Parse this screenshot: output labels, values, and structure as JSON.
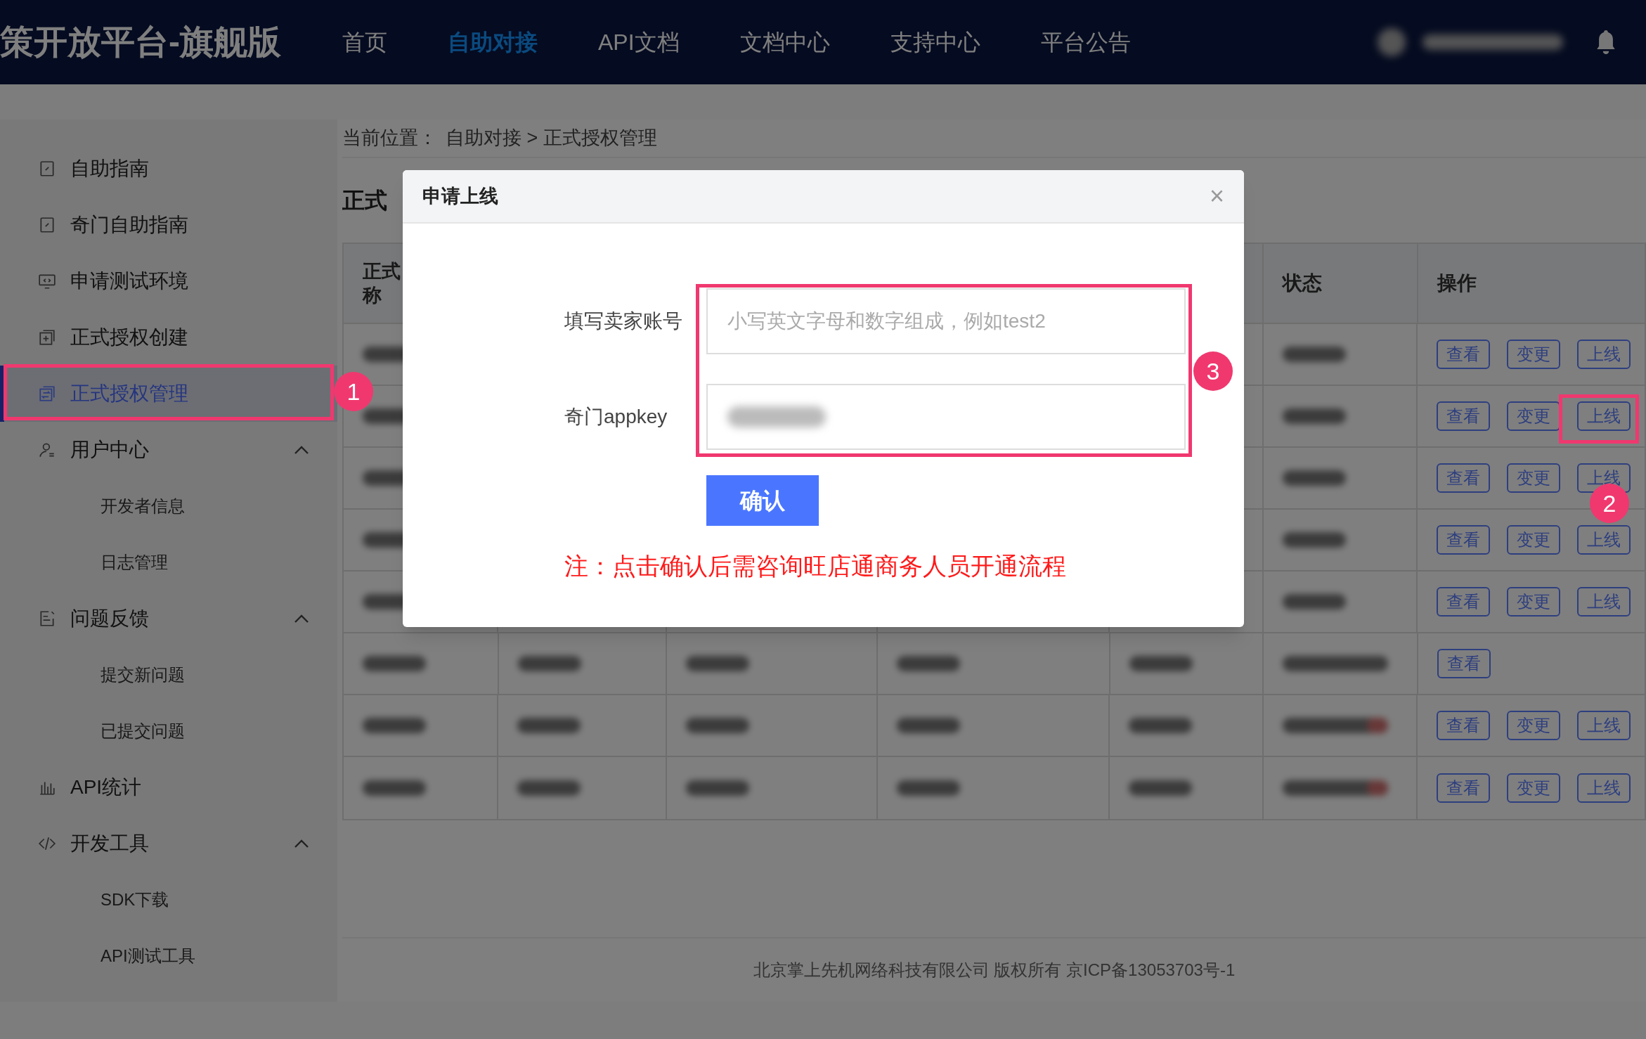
{
  "header": {
    "logo": "策开放平台-旗舰版",
    "nav": [
      {
        "label": "首页",
        "selected": false
      },
      {
        "label": "自助对接",
        "selected": true
      },
      {
        "label": "API文档",
        "selected": false
      },
      {
        "label": "文档中心",
        "selected": false
      },
      {
        "label": "支持中心",
        "selected": false
      },
      {
        "label": "平台公告",
        "selected": false
      }
    ]
  },
  "sidebar": {
    "items": [
      {
        "label": "自助指南",
        "kind": "guide",
        "selected": false
      },
      {
        "label": "奇门自助指南",
        "kind": "guide",
        "selected": false
      },
      {
        "label": "申请测试环境",
        "kind": "monitor",
        "selected": false
      },
      {
        "label": "正式授权创建",
        "kind": "add",
        "selected": false
      },
      {
        "label": "正式授权管理",
        "kind": "manage",
        "selected": true
      },
      {
        "label": "用户中心",
        "kind": "user",
        "selected": false,
        "expanded": true,
        "children": [
          {
            "label": "开发者信息"
          },
          {
            "label": "日志管理"
          }
        ]
      },
      {
        "label": "问题反馈",
        "kind": "feedback",
        "selected": false,
        "expanded": true,
        "children": [
          {
            "label": "提交新问题"
          },
          {
            "label": "已提交问题"
          }
        ]
      },
      {
        "label": "API统计",
        "kind": "chart",
        "selected": false
      },
      {
        "label": "开发工具",
        "kind": "code",
        "selected": false,
        "expanded": true,
        "children": [
          {
            "label": "SDK下载"
          },
          {
            "label": "API测试工具"
          }
        ]
      }
    ]
  },
  "breadcrumb": {
    "prefix": "当前位置：",
    "path": "自助对接 > 正式授权管理"
  },
  "page_title": "正式",
  "table": {
    "column_1": [
      "正式",
      "称"
    ],
    "status_header": "状态",
    "actions_header": "操作",
    "rows": [
      {
        "actions": [
          "查看",
          "变更",
          "上线"
        ]
      },
      {
        "actions": [
          "查看",
          "变更",
          "上线"
        ]
      },
      {
        "actions": [
          "查看",
          "变更",
          "上线"
        ]
      },
      {
        "actions": [
          "查看",
          "变更",
          "上线"
        ]
      },
      {
        "actions": [
          "查看",
          "变更",
          "上线"
        ]
      },
      {
        "actions": [
          "查看"
        ]
      },
      {
        "actions": [
          "查看",
          "变更",
          "上线"
        ]
      },
      {
        "actions": [
          "查看",
          "变更",
          "上线"
        ]
      }
    ]
  },
  "modal": {
    "title": "申请上线",
    "close": "×",
    "fields": [
      {
        "label": "填写卖家账号",
        "placeholder": "小写英文字母和数字组成，例如test2"
      },
      {
        "label": "奇门appkey",
        "kind": "blurred"
      }
    ],
    "button": "确认",
    "note": "注：点击确认后需咨询旺店通商务人员开通流程"
  },
  "markers": [
    "1",
    "2",
    "3"
  ],
  "footer": "北京掌上先机网络科技有限公司 版权所有 京ICP备13053703号-1"
}
